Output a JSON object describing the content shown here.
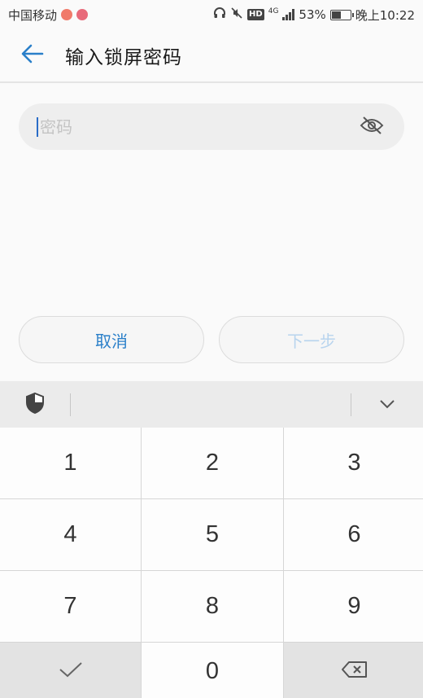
{
  "status_bar": {
    "carrier": "中国移动",
    "network": "4G",
    "battery_percent": "53%",
    "battery_level": 0.53,
    "time": "晚上10:22",
    "hd_label": "HD",
    "icons": [
      "headphones-icon",
      "mute-icon",
      "hd-icon",
      "signal-icon",
      "battery-icon"
    ]
  },
  "header": {
    "back_icon": "arrow-left-icon",
    "title": "输入锁屏密码",
    "accent_color": "#2a7fc9"
  },
  "password_field": {
    "value": "",
    "placeholder": "密码",
    "toggle_icon": "eye-off-icon"
  },
  "buttons": {
    "cancel_label": "取消",
    "next_label": "下一步"
  },
  "keyboard": {
    "toolbar_icons": [
      "shield-icon",
      "chevron-down-icon"
    ],
    "keys": [
      "1",
      "2",
      "3",
      "4",
      "5",
      "6",
      "7",
      "8",
      "9",
      "0"
    ],
    "confirm_icon": "checkmark-icon",
    "delete_icon": "backspace-icon"
  }
}
